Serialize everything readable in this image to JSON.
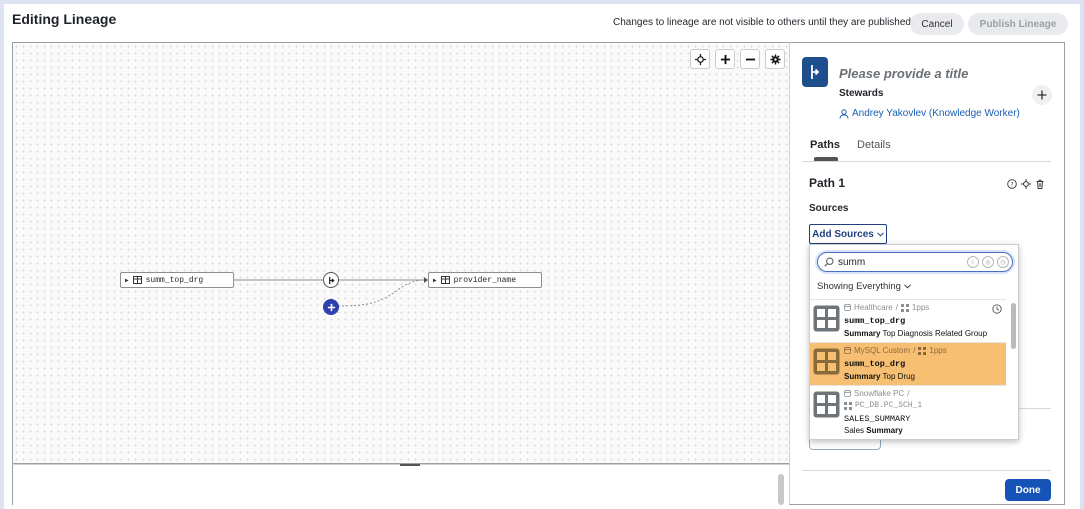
{
  "header": {
    "title": "Editing Lineage",
    "notice": "Changes to lineage are not visible to others until they are published",
    "cancel_label": "Cancel",
    "publish_label": "Publish Lineage"
  },
  "canvas": {
    "tools": [
      "crosshair-icon",
      "plus-icon",
      "minus-icon",
      "gear-icon"
    ],
    "nodes": {
      "source": "summ_top_drg",
      "target": "provider_name"
    }
  },
  "panel": {
    "title_placeholder": "Please provide a title",
    "stewards_label": "Stewards",
    "steward_name": "Andrey Yakovlev (Knowledge Worker)",
    "tabs": [
      "Paths",
      "Details"
    ],
    "path_title": "Path 1",
    "sources_label": "Sources",
    "add_sources_label": "Add Sources",
    "done_label": "Done"
  },
  "dropdown": {
    "search_value": "summ",
    "filter_label": "Showing Everything",
    "results": [
      {
        "source": "Healthcare",
        "schema": "1pps",
        "name": "summ_top_drg",
        "desc_bold": "Summary",
        "desc_rest": " Top Diagnosis Related Group"
      },
      {
        "source": "MySQL Custom",
        "schema": "1pps",
        "name": "summ_top_drg",
        "desc_bold": "Summary",
        "desc_rest": " Top Drug"
      },
      {
        "source": "Snowflake PC",
        "schema": "PC_DB.PC_SCH_1",
        "name": "SALES_SUMMARY",
        "desc_pre": "Sales ",
        "desc_bold": "Summary"
      }
    ]
  },
  "colors": {
    "accent": "#1553b6",
    "selected_row": "#f7bf72",
    "lineage_icon": "#1f4e8c"
  }
}
